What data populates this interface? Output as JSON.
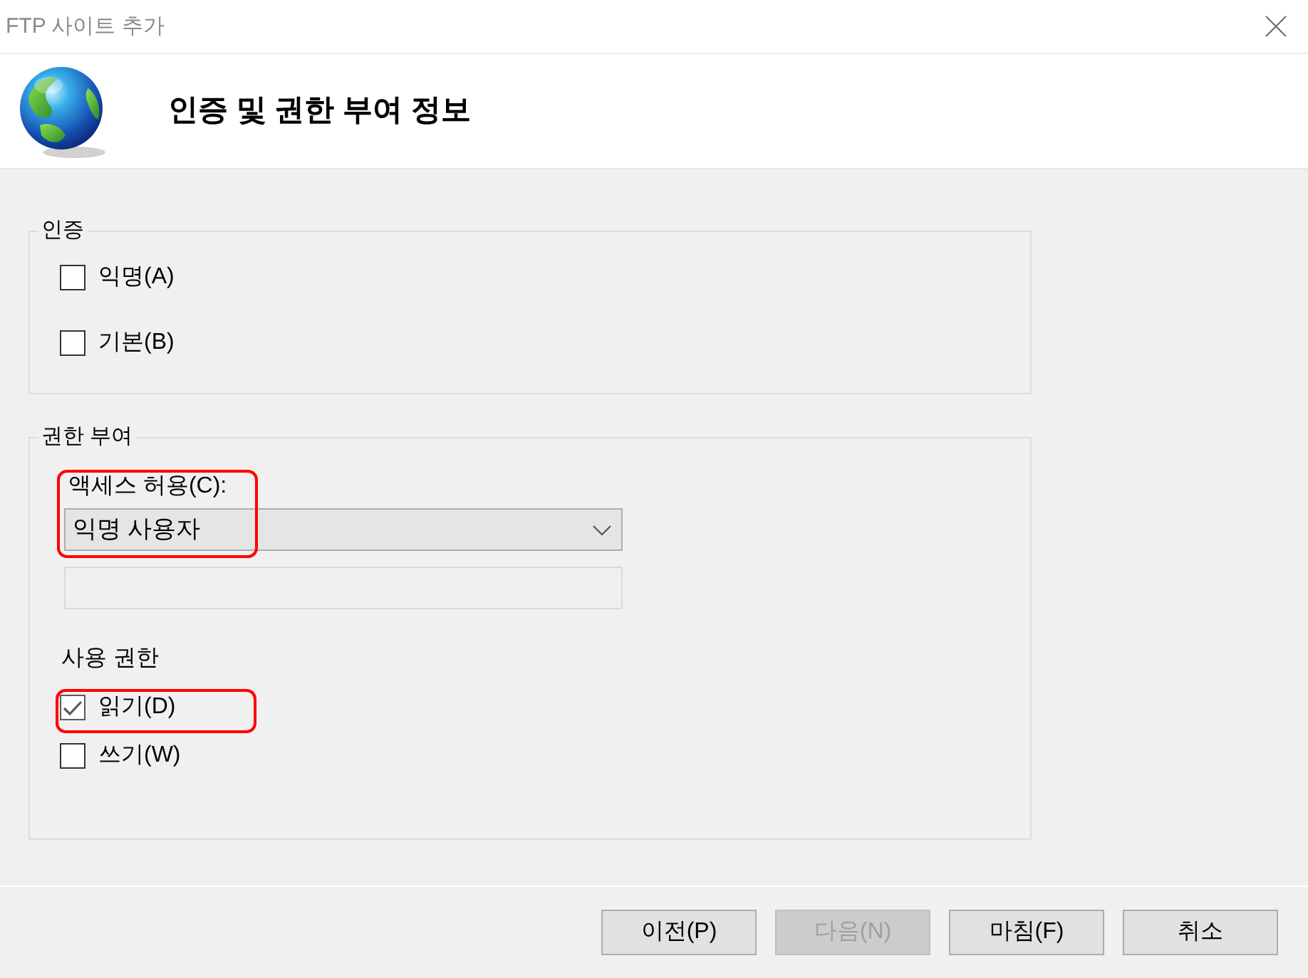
{
  "window": {
    "title": "FTP 사이트 추가"
  },
  "header": {
    "title": "인증 및 권한 부여 정보"
  },
  "authentication": {
    "title": "인증",
    "options": [
      {
        "label": "익명(A)",
        "checked": false
      },
      {
        "label": "기본(B)",
        "checked": false
      }
    ]
  },
  "authorization": {
    "title": "권한 부여",
    "access": {
      "label": "액세스 허용(C):",
      "value": "익명 사용자",
      "highlighted": true
    },
    "user_field": {
      "disabled": true
    },
    "permissions": {
      "title": "사용 권한",
      "options": [
        {
          "label": "읽기(D)",
          "checked": true,
          "highlighted": true
        },
        {
          "label": "쓰기(W)",
          "checked": false,
          "highlighted": false
        }
      ]
    }
  },
  "buttons": [
    {
      "label": "이전(P)",
      "disabled": false
    },
    {
      "label": "다음(N)",
      "disabled": true
    },
    {
      "label": "마침(F)",
      "disabled": false
    },
    {
      "label": "취소",
      "disabled": false
    }
  ]
}
